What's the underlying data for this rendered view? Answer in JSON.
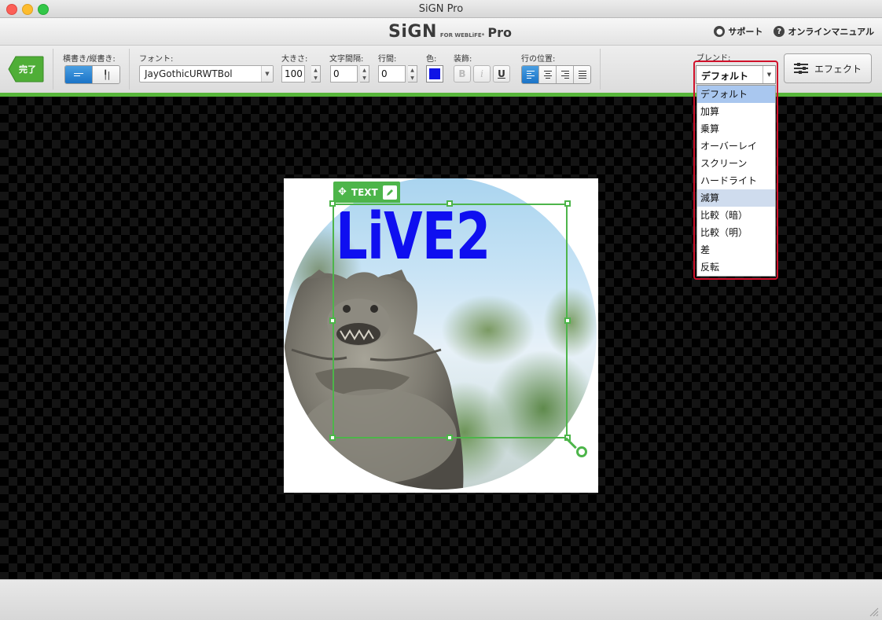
{
  "window": {
    "title": "SiGN Pro"
  },
  "header": {
    "logo_main": "SiGN",
    "logo_sub": "FOR WEBLiFE*",
    "logo_pro": "Pro",
    "support_label": "サポート",
    "manual_label": "オンラインマニュアル"
  },
  "toolbar": {
    "done_label": "完了",
    "orientation_label": "横書き/縦書き:",
    "font_label": "フォント:",
    "font_value": "JayGothicURWTBol",
    "size_label": "大きさ:",
    "size_value": "100",
    "spacing_label": "文字間隔:",
    "spacing_value": "0",
    "line_label": "行間:",
    "line_value": "0",
    "color_label": "色:",
    "color_value": "#0f13e6",
    "decoration_label": "装飾:",
    "bold": "B",
    "italic": "i",
    "underline": "U",
    "align_label": "行の位置:",
    "blend_label": "ブレンド:",
    "blend_value": "デフォルト",
    "effect_label": "エフェクト"
  },
  "blend_options": [
    "デフォルト",
    "加算",
    "乗算",
    "オーバーレイ",
    "スクリーン",
    "ハードライト",
    "減算",
    "比較（暗）",
    "比較（明）",
    "差",
    "反転"
  ],
  "canvas": {
    "text_content": "LiVE2",
    "text_tag_label": "TEXT",
    "text_color": "#0f0ff0"
  },
  "colors": {
    "accent_green": "#58b73b",
    "highlight_red": "#d0102a"
  }
}
